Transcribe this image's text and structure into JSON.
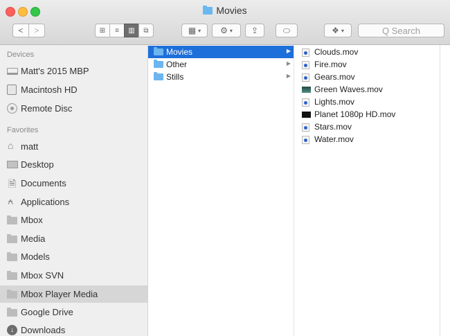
{
  "window": {
    "title": "Movies"
  },
  "toolbar": {
    "back": "<",
    "forward": ">",
    "view_modes": [
      "⊞",
      "≡",
      "▥",
      "⧉"
    ],
    "arrange": "▦",
    "action": "⚙",
    "share": "⇪",
    "tags": "⬭",
    "dropbox": "❖",
    "search_placeholder": "Q Search"
  },
  "sidebar": {
    "devices_title": "Devices",
    "devices": [
      {
        "label": "Matt's 2015 MBP",
        "icon": "laptop-icon"
      },
      {
        "label": "Macintosh HD",
        "icon": "hard-disk-icon"
      },
      {
        "label": "Remote Disc",
        "icon": "disc-icon"
      }
    ],
    "favorites_title": "Favorites",
    "favorites": [
      {
        "label": "matt",
        "icon": "home-icon"
      },
      {
        "label": "Desktop",
        "icon": "desktop-icon"
      },
      {
        "label": "Documents",
        "icon": "documents-icon"
      },
      {
        "label": "Applications",
        "icon": "applications-icon"
      },
      {
        "label": "Mbox",
        "icon": "folder-icon"
      },
      {
        "label": "Media",
        "icon": "folder-icon"
      },
      {
        "label": "Models",
        "icon": "folder-icon"
      },
      {
        "label": "Mbox SVN",
        "icon": "folder-icon"
      },
      {
        "label": "Mbox Player Media",
        "icon": "folder-icon",
        "selected": true
      },
      {
        "label": "Google Drive",
        "icon": "folder-icon"
      },
      {
        "label": "Downloads",
        "icon": "downloads-icon"
      }
    ]
  },
  "column1": {
    "items": [
      {
        "label": "Movies",
        "selected": true
      },
      {
        "label": "Other"
      },
      {
        "label": "Stills"
      }
    ]
  },
  "column2": {
    "items": [
      {
        "label": "Clouds.mov"
      },
      {
        "label": "Fire.mov"
      },
      {
        "label": "Gears.mov"
      },
      {
        "label": "Green Waves.mov"
      },
      {
        "label": "Lights.mov"
      },
      {
        "label": "Planet 1080p HD.mov"
      },
      {
        "label": "Stars.mov"
      },
      {
        "label": "Water.mov"
      }
    ]
  },
  "colors": {
    "selection": "#1d6fda",
    "folder": "#6cb5ef",
    "sidebar_selected": "#d6d6d6"
  }
}
